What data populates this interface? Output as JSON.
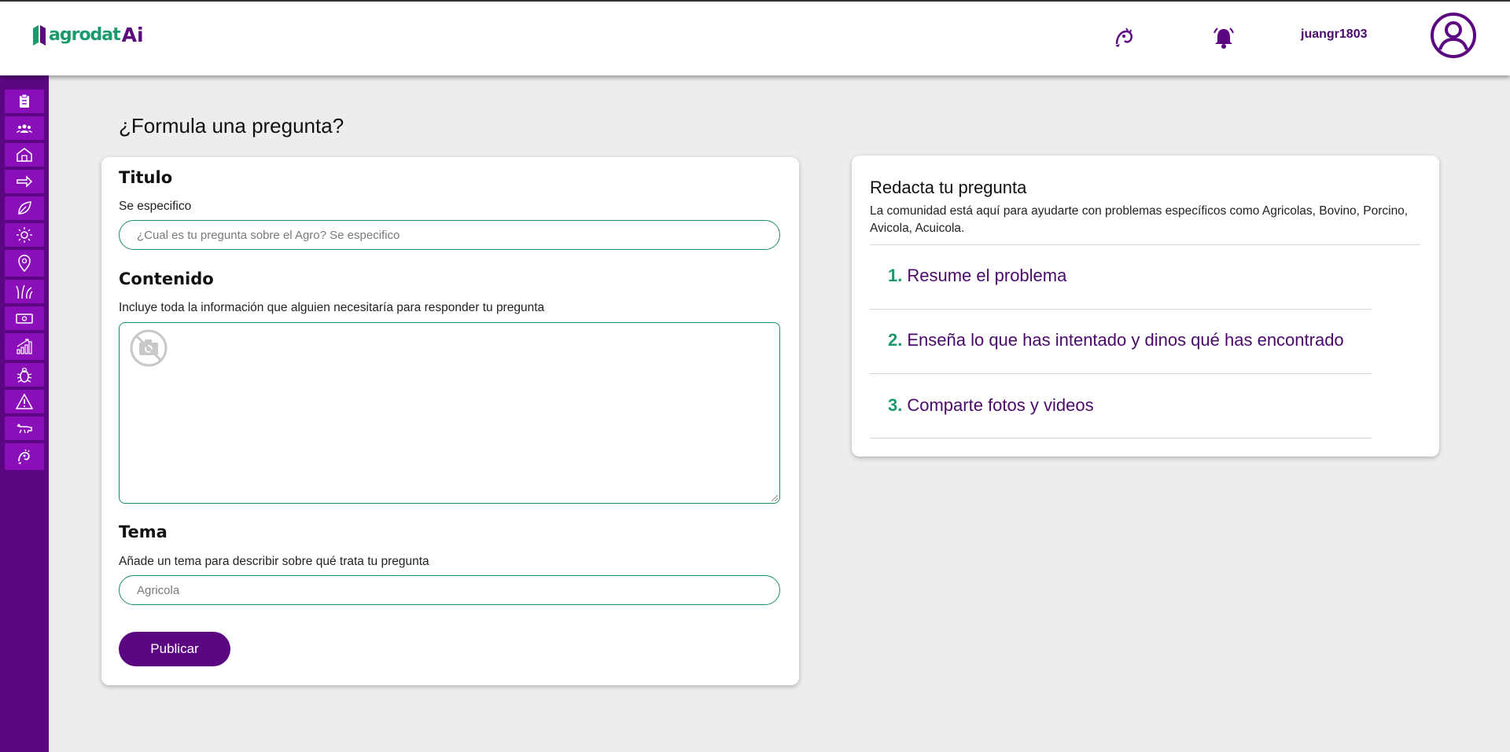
{
  "header": {
    "logo_text": "agrodat",
    "logo_ai": "Ai",
    "username": "juangr1803",
    "icons": [
      "assistant-icon",
      "bell-icon",
      "user-avatar-icon"
    ]
  },
  "sidebar": {
    "items": [
      {
        "name": "clipboard-icon"
      },
      {
        "name": "group-icon"
      },
      {
        "name": "barn-icon"
      },
      {
        "name": "arrow-right-icon"
      },
      {
        "name": "leaf-icon"
      },
      {
        "name": "sun-icon"
      },
      {
        "name": "location-pin-icon"
      },
      {
        "name": "grass-icon"
      },
      {
        "name": "money-icon"
      },
      {
        "name": "chart-growth-icon"
      },
      {
        "name": "bug-icon"
      },
      {
        "name": "warning-icon"
      },
      {
        "name": "animal-icon"
      },
      {
        "name": "assistant-icon"
      }
    ]
  },
  "main": {
    "title": "¿Formula una pregunta?"
  },
  "form": {
    "title_heading": "Titulo",
    "title_sub": "Se especifico",
    "title_placeholder": "¿Cual es tu pregunta sobre el Agro? Se especifico",
    "content_heading": "Contenido",
    "content_sub": "Incluye toda la información que alguien necesitaría para responder tu pregunta",
    "topic_heading": "Tema",
    "topic_sub": "Añade un tema para describir sobre qué trata tu pregunta",
    "topic_placeholder": "Agricola",
    "publish_label": "Publicar"
  },
  "help": {
    "title": "Redacta tu pregunta",
    "description": "La comunidad está aquí para ayudarte con problemas específicos como Agricolas, Bovino, Porcino, Avicola, Acuicola.",
    "steps": [
      {
        "num": "1.",
        "text": "Resume el problema"
      },
      {
        "num": "2.",
        "text": "Enseña lo que has intentado y dinos qué has encontrado"
      },
      {
        "num": "3.",
        "text": "Comparte fotos y videos"
      }
    ]
  },
  "colors": {
    "brand_purple": "#5c0782",
    "sidebar_item": "#8a0fb8",
    "accent_green": "#1a9a6c",
    "background": "#ededed"
  }
}
